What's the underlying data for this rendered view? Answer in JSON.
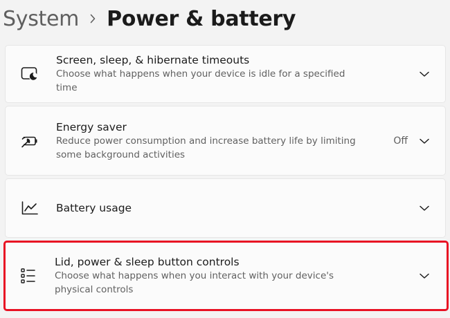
{
  "breadcrumb": {
    "parent": "System",
    "current": "Power & battery"
  },
  "settings": [
    {
      "title": "Screen, sleep, & hibernate timeouts",
      "description": "Choose what happens when your device is idle for a specified time",
      "icon": "screen-sleep-icon"
    },
    {
      "title": "Energy saver",
      "description": "Reduce power consumption and increase battery life by limiting some background activities",
      "value": "Off",
      "icon": "energy-saver-icon"
    },
    {
      "title": "Battery usage",
      "icon": "battery-usage-icon"
    },
    {
      "title": "Lid, power & sleep button controls",
      "description": "Choose what happens when you interact with your device's physical controls",
      "icon": "list-controls-icon",
      "highlighted": true
    }
  ],
  "colors": {
    "background": "#f3f3f3",
    "card": "#fbfbfb",
    "highlight_border": "#e81123",
    "secondary_text": "#606060"
  }
}
